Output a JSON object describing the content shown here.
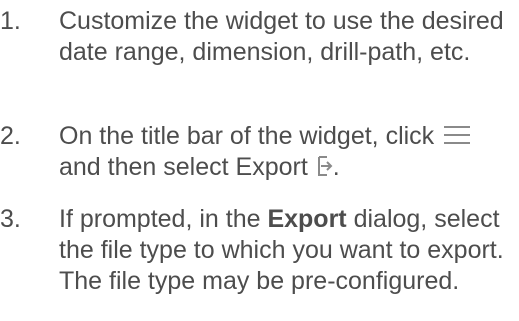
{
  "steps": [
    {
      "number": "1.",
      "text": "Customize the widget to use the desired date range, dimension, drill-path, etc."
    },
    {
      "number": "2.",
      "text_before_menu": "On the title bar of the widget, click ",
      "text_after_menu": "and then select Export ",
      "text_end": ".",
      "menu_icon": "hamburger-menu-icon",
      "export_icon": "export-icon"
    },
    {
      "number": "3.",
      "text_before_bold": "If prompted, in the ",
      "bold": "Export",
      "text_after_bold": " dialog, select the file type to which you want to export. The file type may be pre-configured."
    }
  ],
  "colors": {
    "text": "#4d4d4d",
    "icon": "#8a8a8a"
  }
}
